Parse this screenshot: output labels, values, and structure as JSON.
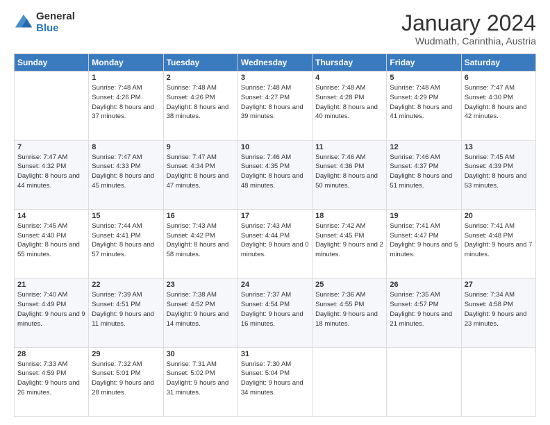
{
  "logo": {
    "general": "General",
    "blue": "Blue"
  },
  "header": {
    "title": "January 2024",
    "subtitle": "Wudmath, Carinthia, Austria"
  },
  "weekdays": [
    "Sunday",
    "Monday",
    "Tuesday",
    "Wednesday",
    "Thursday",
    "Friday",
    "Saturday"
  ],
  "weeks": [
    [
      {
        "day": null,
        "data": null
      },
      {
        "day": 1,
        "data": {
          "sunrise": "7:48 AM",
          "sunset": "4:26 PM",
          "daylight": "8 hours and 37 minutes."
        }
      },
      {
        "day": 2,
        "data": {
          "sunrise": "7:48 AM",
          "sunset": "4:26 PM",
          "daylight": "8 hours and 38 minutes."
        }
      },
      {
        "day": 3,
        "data": {
          "sunrise": "7:48 AM",
          "sunset": "4:27 PM",
          "daylight": "8 hours and 39 minutes."
        }
      },
      {
        "day": 4,
        "data": {
          "sunrise": "7:48 AM",
          "sunset": "4:28 PM",
          "daylight": "8 hours and 40 minutes."
        }
      },
      {
        "day": 5,
        "data": {
          "sunrise": "7:48 AM",
          "sunset": "4:29 PM",
          "daylight": "8 hours and 41 minutes."
        }
      },
      {
        "day": 6,
        "data": {
          "sunrise": "7:47 AM",
          "sunset": "4:30 PM",
          "daylight": "8 hours and 42 minutes."
        }
      }
    ],
    [
      {
        "day": 7,
        "data": {
          "sunrise": "7:47 AM",
          "sunset": "4:32 PM",
          "daylight": "8 hours and 44 minutes."
        }
      },
      {
        "day": 8,
        "data": {
          "sunrise": "7:47 AM",
          "sunset": "4:33 PM",
          "daylight": "8 hours and 45 minutes."
        }
      },
      {
        "day": 9,
        "data": {
          "sunrise": "7:47 AM",
          "sunset": "4:34 PM",
          "daylight": "8 hours and 47 minutes."
        }
      },
      {
        "day": 10,
        "data": {
          "sunrise": "7:46 AM",
          "sunset": "4:35 PM",
          "daylight": "8 hours and 48 minutes."
        }
      },
      {
        "day": 11,
        "data": {
          "sunrise": "7:46 AM",
          "sunset": "4:36 PM",
          "daylight": "8 hours and 50 minutes."
        }
      },
      {
        "day": 12,
        "data": {
          "sunrise": "7:46 AM",
          "sunset": "4:37 PM",
          "daylight": "8 hours and 51 minutes."
        }
      },
      {
        "day": 13,
        "data": {
          "sunrise": "7:45 AM",
          "sunset": "4:39 PM",
          "daylight": "8 hours and 53 minutes."
        }
      }
    ],
    [
      {
        "day": 14,
        "data": {
          "sunrise": "7:45 AM",
          "sunset": "4:40 PM",
          "daylight": "8 hours and 55 minutes."
        }
      },
      {
        "day": 15,
        "data": {
          "sunrise": "7:44 AM",
          "sunset": "4:41 PM",
          "daylight": "8 hours and 57 minutes."
        }
      },
      {
        "day": 16,
        "data": {
          "sunrise": "7:43 AM",
          "sunset": "4:42 PM",
          "daylight": "8 hours and 58 minutes."
        }
      },
      {
        "day": 17,
        "data": {
          "sunrise": "7:43 AM",
          "sunset": "4:44 PM",
          "daylight": "9 hours and 0 minutes."
        }
      },
      {
        "day": 18,
        "data": {
          "sunrise": "7:42 AM",
          "sunset": "4:45 PM",
          "daylight": "9 hours and 2 minutes."
        }
      },
      {
        "day": 19,
        "data": {
          "sunrise": "7:41 AM",
          "sunset": "4:47 PM",
          "daylight": "9 hours and 5 minutes."
        }
      },
      {
        "day": 20,
        "data": {
          "sunrise": "7:41 AM",
          "sunset": "4:48 PM",
          "daylight": "9 hours and 7 minutes."
        }
      }
    ],
    [
      {
        "day": 21,
        "data": {
          "sunrise": "7:40 AM",
          "sunset": "4:49 PM",
          "daylight": "9 hours and 9 minutes."
        }
      },
      {
        "day": 22,
        "data": {
          "sunrise": "7:39 AM",
          "sunset": "4:51 PM",
          "daylight": "9 hours and 11 minutes."
        }
      },
      {
        "day": 23,
        "data": {
          "sunrise": "7:38 AM",
          "sunset": "4:52 PM",
          "daylight": "9 hours and 14 minutes."
        }
      },
      {
        "day": 24,
        "data": {
          "sunrise": "7:37 AM",
          "sunset": "4:54 PM",
          "daylight": "9 hours and 16 minutes."
        }
      },
      {
        "day": 25,
        "data": {
          "sunrise": "7:36 AM",
          "sunset": "4:55 PM",
          "daylight": "9 hours and 18 minutes."
        }
      },
      {
        "day": 26,
        "data": {
          "sunrise": "7:35 AM",
          "sunset": "4:57 PM",
          "daylight": "9 hours and 21 minutes."
        }
      },
      {
        "day": 27,
        "data": {
          "sunrise": "7:34 AM",
          "sunset": "4:58 PM",
          "daylight": "9 hours and 23 minutes."
        }
      }
    ],
    [
      {
        "day": 28,
        "data": {
          "sunrise": "7:33 AM",
          "sunset": "4:59 PM",
          "daylight": "9 hours and 26 minutes."
        }
      },
      {
        "day": 29,
        "data": {
          "sunrise": "7:32 AM",
          "sunset": "5:01 PM",
          "daylight": "9 hours and 28 minutes."
        }
      },
      {
        "day": 30,
        "data": {
          "sunrise": "7:31 AM",
          "sunset": "5:02 PM",
          "daylight": "9 hours and 31 minutes."
        }
      },
      {
        "day": 31,
        "data": {
          "sunrise": "7:30 AM",
          "sunset": "5:04 PM",
          "daylight": "9 hours and 34 minutes."
        }
      },
      {
        "day": null,
        "data": null
      },
      {
        "day": null,
        "data": null
      },
      {
        "day": null,
        "data": null
      }
    ]
  ]
}
